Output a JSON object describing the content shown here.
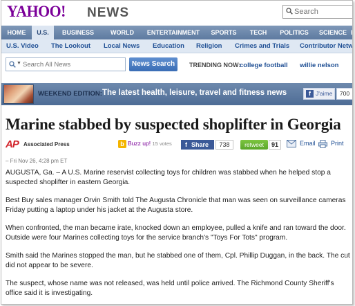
{
  "brand": {
    "logo": "YAHOO!",
    "section": "NEWS"
  },
  "search": {
    "placeholder": "Search"
  },
  "nav": {
    "tabs": [
      {
        "label": "HOME"
      },
      {
        "label": "U.S."
      },
      {
        "label": "BUSINESS"
      },
      {
        "label": "WORLD"
      },
      {
        "label": "ENTERTAINMENT"
      },
      {
        "label": "SPORTS"
      },
      {
        "label": "TECH"
      },
      {
        "label": "POLITICS"
      },
      {
        "label": "SCIENCE"
      },
      {
        "label": "H"
      }
    ],
    "active": "U.S."
  },
  "subnav": {
    "items": [
      {
        "label": "U.S. Video"
      },
      {
        "label": "The Lookout"
      },
      {
        "label": "Local News"
      },
      {
        "label": "Education"
      },
      {
        "label": "Religion"
      },
      {
        "label": "Crimes and Trials"
      },
      {
        "label": "Contributor Netwo"
      }
    ]
  },
  "newsSearch": {
    "placeholder": "Search All News",
    "button": "News Search"
  },
  "trending": {
    "label": "TRENDING NOW:",
    "items": [
      "college football",
      "willie nelson"
    ]
  },
  "banner": {
    "label": "WEEKEND EDITION:",
    "headline": "The latest health, leisure, travel and fitness news",
    "like": "J'aime",
    "likeCount": "700"
  },
  "article": {
    "title": "Marine stabbed by suspected shoplifter in Georgia",
    "source": "Associated Press",
    "buzz": {
      "label": "Buzz up!",
      "votes": "15 votes"
    },
    "share": {
      "label": "Share",
      "count": "738"
    },
    "retweet": {
      "label": "retweet",
      "count": "91"
    },
    "email": "Email",
    "print": "Print",
    "dateline": "– Fri Nov 26, 4:28 pm ET",
    "paragraphs": [
      "AUGUSTA, Ga. – A U.S. Marine reservist collecting toys for children was stabbed when he helped stop a suspected shoplifter in eastern Georgia.",
      "Best Buy sales manager Orvin Smith told The Augusta Chronicle that man was seen on surveillance cameras Friday putting a laptop under his jacket at the Augusta store.",
      "When confronted, the man became irate, knocked down an employee, pulled a knife and ran toward the door. Outside were four Marines collecting toys for the service branch's \"Toys For Tots\" program.",
      "Smith said the Marines stopped the man, but he stabbed one of them, Cpl. Phillip Duggan, in the back. The cut did not appear to be severe.",
      "The suspect, whose name was not released, was held until police arrived. The Richmond County Sheriff's office said it is investigating."
    ]
  },
  "colors": {
    "yahooPurple": "#7b0099",
    "navBlue": "#5d7aa0",
    "linkBlue": "#1f4f94",
    "apRed": "#d2232a"
  }
}
